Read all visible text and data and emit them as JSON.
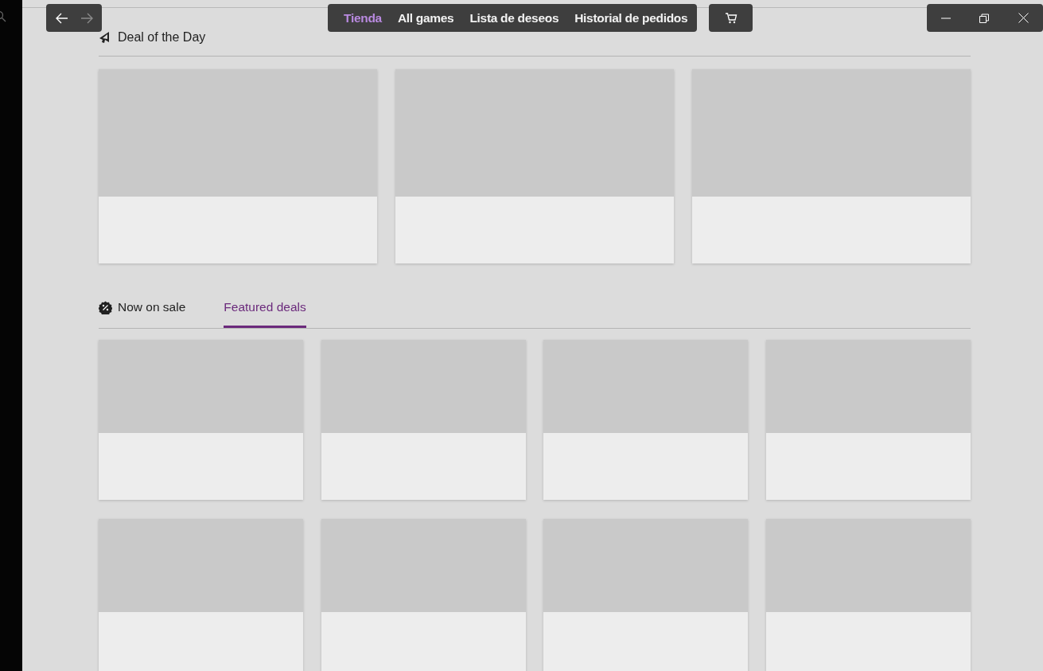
{
  "nav": {
    "back_disabled": false,
    "forward_disabled": true
  },
  "tabs": [
    {
      "label": "Tienda",
      "selected": true
    },
    {
      "label": "All games",
      "selected": false
    },
    {
      "label": "Lista de deseos",
      "selected": false
    },
    {
      "label": "Historial de pedidos",
      "selected": false
    }
  ],
  "deal_of_the_day": {
    "title": "Deal of the Day",
    "cards": [
      {
        "kind": "placeholder"
      },
      {
        "kind": "placeholder"
      },
      {
        "kind": "placeholder"
      }
    ]
  },
  "sale_tabs": [
    {
      "label": "Now on sale",
      "selected": false
    },
    {
      "label": "Featured deals",
      "selected": true
    }
  ],
  "sale_cards": [
    {
      "kind": "placeholder"
    },
    {
      "kind": "placeholder"
    },
    {
      "kind": "placeholder"
    },
    {
      "kind": "placeholder"
    },
    {
      "kind": "placeholder"
    },
    {
      "kind": "placeholder"
    },
    {
      "kind": "placeholder"
    },
    {
      "kind": "placeholder"
    }
  ]
}
